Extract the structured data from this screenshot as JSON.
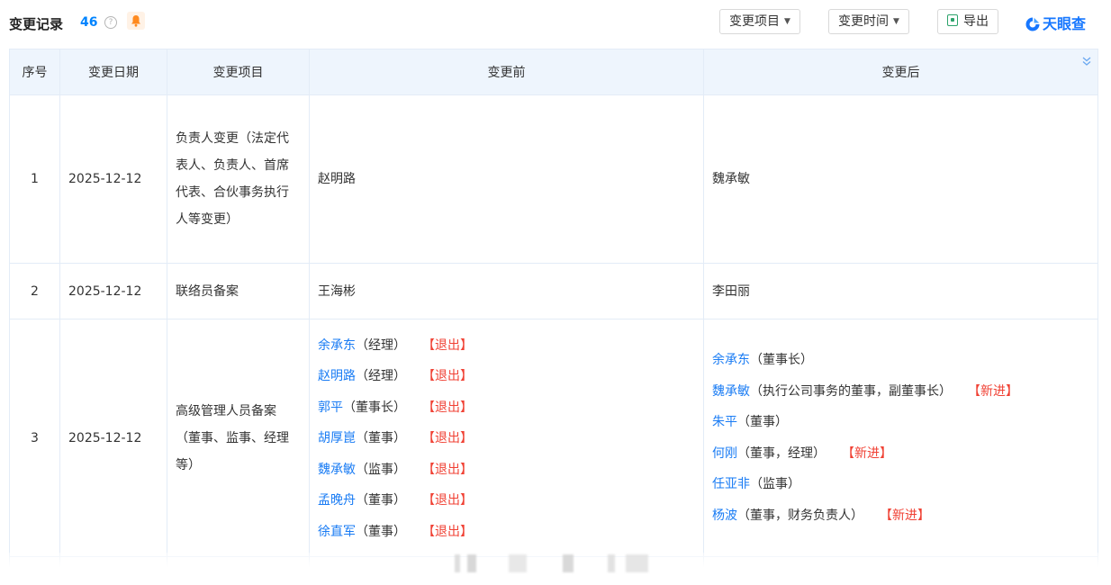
{
  "header": {
    "title": "变更记录",
    "count": "46",
    "help_glyph": "?",
    "buttons": {
      "filter_item": "变更项目",
      "filter_time": "变更时间",
      "export": "导出"
    },
    "brand": "天眼查",
    "brand_color": "#1677ff"
  },
  "table": {
    "columns": [
      "序号",
      "变更日期",
      "变更项目",
      "变更前",
      "变更后"
    ],
    "rows": [
      {
        "index": "1",
        "date": "2025-12-12",
        "item": "负责人变更（法定代表人、负责人、首席代表、合伙事务执行人等变更）",
        "before": "赵明路",
        "after": "魏承敏"
      },
      {
        "index": "2",
        "date": "2025-12-12",
        "item": "联络员备案",
        "before": "王海彬",
        "after": "李田丽"
      },
      {
        "index": "3",
        "date": "2025-12-12",
        "item": "高级管理人员备案（董事、监事、经理等）",
        "before_lines": [
          {
            "name": "余承东",
            "role": "（经理）",
            "tag": "【退出】"
          },
          {
            "name": "赵明路",
            "role": "（经理）",
            "tag": "【退出】"
          },
          {
            "name": "郭平",
            "role": "（董事长）",
            "tag": "【退出】"
          },
          {
            "name": "胡厚崑",
            "role": "（董事）",
            "tag": "【退出】"
          },
          {
            "name": "魏承敏",
            "role": "（监事）",
            "tag": "【退出】"
          },
          {
            "name": "孟晚舟",
            "role": "（董事）",
            "tag": "【退出】"
          },
          {
            "name": "徐直军",
            "role": "（董事）",
            "tag": "【退出】"
          }
        ],
        "after_lines": [
          {
            "name": "余承东",
            "role": "（董事长）",
            "tag": ""
          },
          {
            "name": "魏承敏",
            "role": "（执行公司事务的董事，副董事长）",
            "tag": "【新进】"
          },
          {
            "name": "朱平",
            "role": "（董事）",
            "tag": ""
          },
          {
            "name": "何刚",
            "role": "（董事，经理）",
            "tag": "【新进】"
          },
          {
            "name": "任亚非",
            "role": "（监事）",
            "tag": ""
          },
          {
            "name": "杨波",
            "role": "（董事，财务负责人）",
            "tag": "【新进】"
          }
        ]
      }
    ]
  }
}
